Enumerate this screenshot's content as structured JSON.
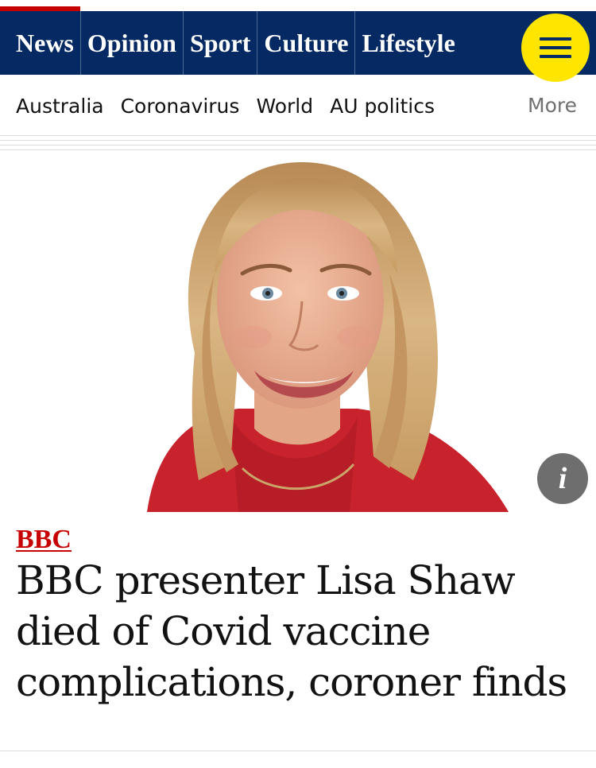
{
  "nav": {
    "pillars": [
      {
        "label": "News",
        "active": true
      },
      {
        "label": "Opinion"
      },
      {
        "label": "Sport"
      },
      {
        "label": "Culture"
      },
      {
        "label": "Lifestyle"
      }
    ],
    "menu_icon": "hamburger-menu-icon",
    "colors": {
      "nav_bg": "#052962",
      "active_accent": "#c70000",
      "menu_button": "#ffe500"
    }
  },
  "subnav": {
    "items": [
      "Australia",
      "Coronavirus",
      "World",
      "AU politics"
    ],
    "more_label": "More"
  },
  "hero": {
    "image": "portrait of smiling blonde woman in red top on white background",
    "info_icon_label": "i"
  },
  "article": {
    "kicker": "BBC",
    "headline": "BBC presenter Lisa Shaw died of Covid vaccine complications, coroner finds",
    "kicker_color": "#c70000"
  }
}
